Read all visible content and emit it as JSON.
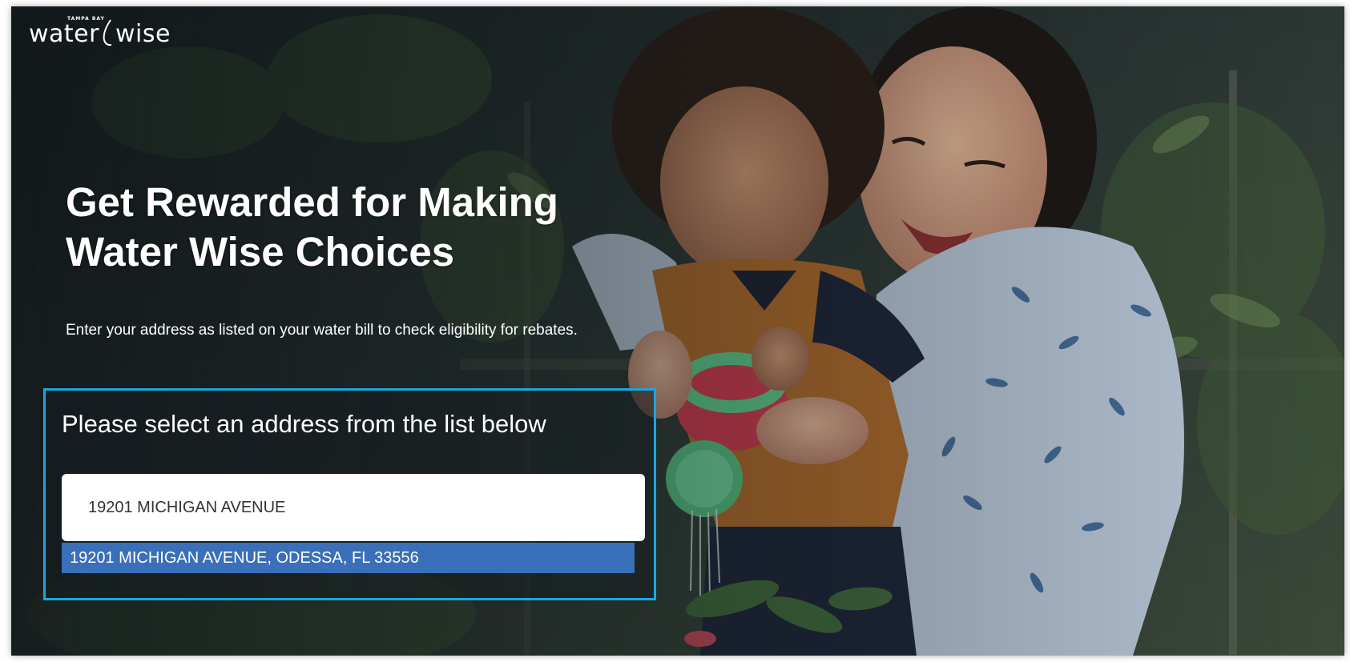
{
  "logo": {
    "tagline": "TAMPA BAY",
    "word_left": "water",
    "word_right": "wise"
  },
  "hero": {
    "headline_line1": "Get Rewarded for Making",
    "headline_line2": "Water Wise Choices",
    "instructions": "Enter your address as listed on your water bill to check eligibility for rebates."
  },
  "address_panel": {
    "title": "Please select an address from the list below",
    "input_value": "19201 MICHIGAN AVENUE",
    "suggestions": [
      "19201 MICHIGAN AVENUE, ODESSA, FL 33556"
    ]
  },
  "colors": {
    "panel_border": "#1aa7e0",
    "suggestion_highlight": "#3a6fba",
    "text": "#ffffff"
  }
}
